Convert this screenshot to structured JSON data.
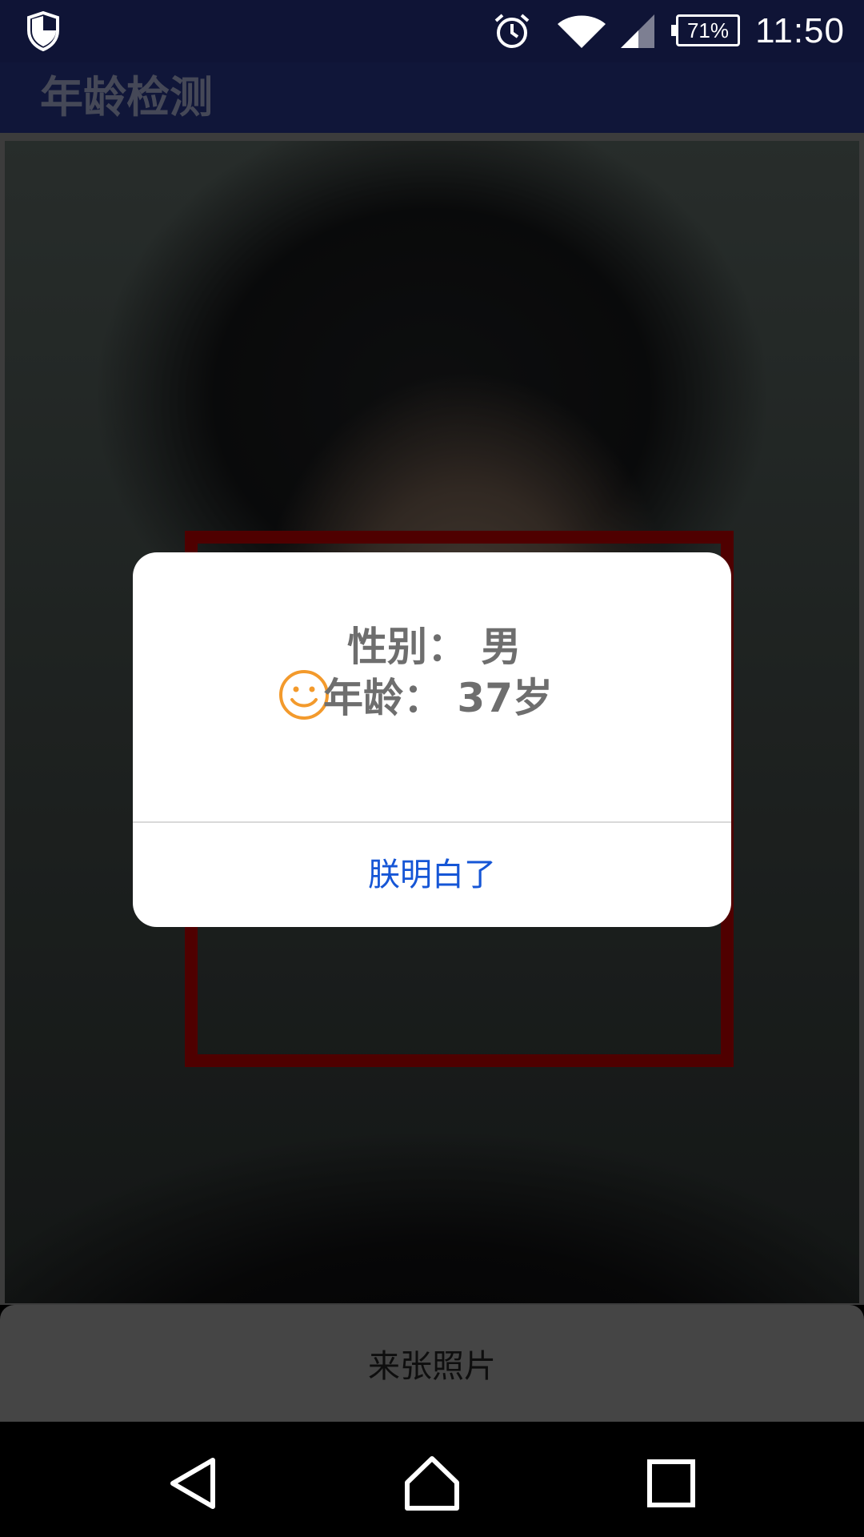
{
  "status_bar": {
    "time": "11:50",
    "battery": "71%",
    "icons": [
      "shield-icon",
      "alarm-icon",
      "wifi-icon",
      "signal-icon",
      "battery-icon"
    ]
  },
  "app_bar": {
    "title": "年龄检测"
  },
  "dialog": {
    "gender_line": "性别： 男",
    "age_line": "年龄： 37岁",
    "icon": "smile-icon",
    "icon_color": "#f39a2c",
    "confirm_label": "朕明白了",
    "confirm_color": "#1656d6"
  },
  "main": {
    "face_box_color": "#7a0000",
    "take_photo_label": "来张照片"
  },
  "nav_bar": {
    "buttons": [
      "back-icon",
      "home-icon",
      "recent-apps-icon"
    ]
  }
}
